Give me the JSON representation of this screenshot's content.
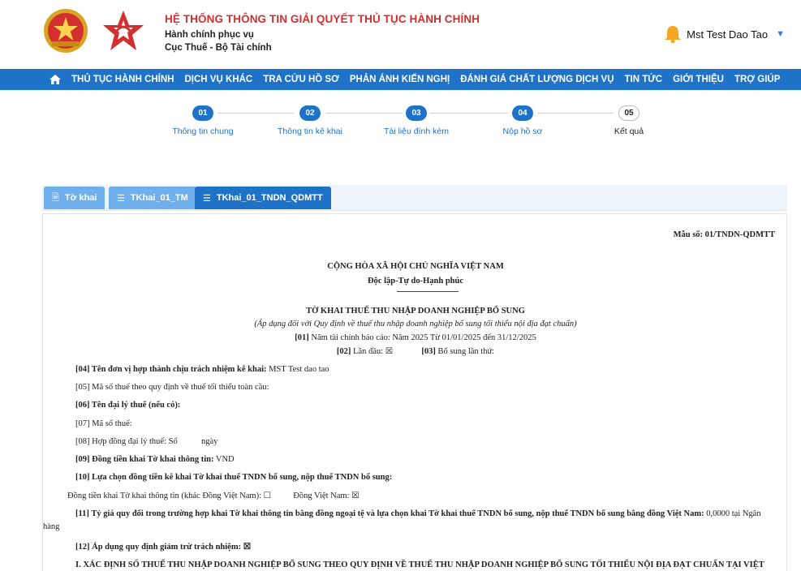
{
  "header": {
    "title": "HỆ THỐNG THÔNG TIN GIẢI QUYẾT THỦ TỤC HÀNH CHÍNH",
    "sub1": "Hành chính phục vụ",
    "sub2": "Cục Thuế - Bộ Tài chính",
    "user_name": "Mst Test Dao Tao",
    "user_caret": "▼"
  },
  "nav": {
    "items": [
      "THỦ TỤC HÀNH CHÍNH",
      "DỊCH VỤ KHÁC",
      "TRA CỨU HỒ SƠ",
      "PHẢN ÁNH KIẾN NGHỊ",
      "ĐÁNH GIÁ CHẤT LƯỢNG DỊCH VỤ",
      "TIN TỨC",
      "GIỚI THIỆU",
      "TRỢ GIÚP"
    ]
  },
  "stepper": {
    "steps": [
      {
        "num": "01",
        "label": "Thông tin chung",
        "done": true
      },
      {
        "num": "02",
        "label": "Thông tin kê khai",
        "done": true
      },
      {
        "num": "03",
        "label": "Tài liệu đính kèm",
        "done": true
      },
      {
        "num": "04",
        "label": "Nộp hồ sơ",
        "done": true
      },
      {
        "num": "05",
        "label": "Kết quả",
        "done": false
      }
    ]
  },
  "tabs": [
    {
      "label": "Tờ khai",
      "icon": "doc-icon",
      "active": false
    },
    {
      "label": "TKhai_01_TM",
      "icon": "list-icon",
      "active": false
    },
    {
      "label": "TKhai_01_TNDN_QDMTT",
      "icon": "list-icon",
      "active": true
    }
  ],
  "doc": {
    "form_no": "Mẫu số: 01/TNDN-QDMTT",
    "nation": "CỘNG HÒA XÃ HỘI CHỦ NGHĨA VIỆT NAM",
    "motto": "Độc lập-Tự do-Hạnh phúc",
    "title": "TỜ KHAI THUẾ THU NHẬP DOANH NGHIỆP BỔ SUNG",
    "subtitle": "(Áp dụng đối với Quy định về thuế thu nhập doanh nghiệp bổ sung tối thiểu nội địa đạt chuẩn)",
    "f01_code": "[01]",
    "f01_text": "Năm tài chính báo cáo: Năm 2025 Từ 01/01/2025 đến 31/12/2025",
    "f02_code": "[02]",
    "f02_text": "Lần đầu: ☒",
    "f03_code": "[03]",
    "f03_text": "Bổ sung lần thứ:",
    "f04_label": "[04] Tên đơn vị hợp thành chịu trách nhiệm kê khai:",
    "f04_value": "MST Test dao tao",
    "f05": "[05] Mã số thuế theo quy định về thuế tối thiểu toàn cầu:",
    "f06": "[06] Tên đại lý thuế (nếu có):",
    "f07": "[07] Mã số thuế:",
    "f08a": "[08] Hợp đồng đại lý thuế: Số",
    "f08b": "ngày",
    "f09_label": "[09] Đồng tiền khai Tờ khai thông tin:",
    "f09_value": "VND",
    "f10": "[10] Lựa chọn đồng tiền kê khai Tờ khai thuế TNDN bổ sung, nộp thuế TNDN bổ sung:",
    "f10_opt1": "Đồng tiền khai Tờ khai thông tin (khác Đồng Việt Nam): ☐",
    "f10_opt2": "Đồng Việt Nam: ☒",
    "f11_label": "[11] Tỷ giá quy đổi trong trường hợp khai Tờ khai thông tin bằng đồng ngoại tệ và lựa chọn khai Tờ khai thuế TNDN bổ sung, nộp thuế TNDN bổ sung bằng đồng Việt Nam:",
    "f11_value": "0,0000 tại Ngân",
    "f11_cont": "hàng",
    "f12": "[12] Áp dụng quy định giảm trừ trách nhiệm: ☒",
    "section1": "I. XÁC ĐỊNH SỐ THUẾ THU NHẬP DOANH NGHIỆP BỔ SUNG THEO QUY ĐỊNH VỀ THUẾ THU NHẬP DOANH NGHIỆP BỔ SUNG TỐI THIỂU NỘI ĐỊA ĐẠT CHUẨN TẠI VIỆT"
  }
}
